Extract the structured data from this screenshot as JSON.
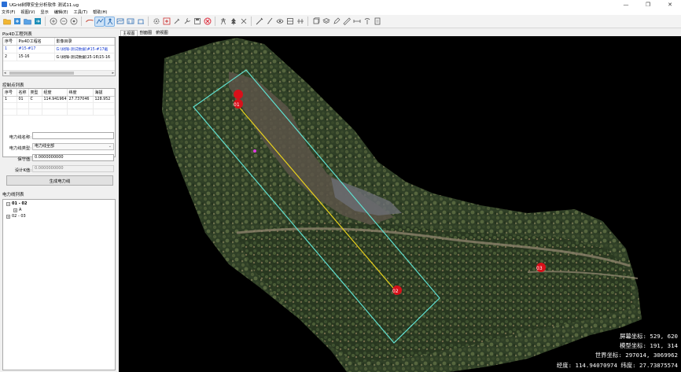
{
  "window": {
    "title": "UGrid树障安全分析软件 测试11.ug",
    "buttons": [
      "—",
      "❐",
      "✕"
    ]
  },
  "menu": [
    "文件(F)",
    "视图(V)",
    "显示",
    "编辑(E)",
    "工具(T)",
    "帮助(H)"
  ],
  "toolbar": {
    "icons": [
      "open-folder-icon",
      "import-icon",
      "save-icon",
      "export-icon",
      "zoom-in-icon",
      "zoom-out-icon",
      "full-extent-icon",
      "pan-hand-icon",
      "select-icon",
      "point-cloud-icon",
      "measure-icon",
      "box-select-icon",
      "profile-icon",
      "settings-gear-icon",
      "add-point-icon",
      "filter-icon",
      "tools-icon",
      "save-disk-icon",
      "stop-icon",
      "help-icon",
      "tower-icon",
      "tree-icon",
      "classify-icon",
      "draw-line-icon",
      "brush-icon",
      "eye-icon",
      "layers-icon",
      "cube-icon",
      "stack-icon",
      "edit-icon",
      "ruler-icon",
      "wrench-icon",
      "antenna-icon",
      "report-icon"
    ],
    "active": [
      7,
      8
    ]
  },
  "project_panel": {
    "title": "Pix4D工程列表",
    "columns": [
      "序号",
      "Pix4D工程名",
      "影像目录"
    ],
    "rows": [
      [
        "1",
        "#15-#17",
        "G:\\树障-测试数据\\#15-#17截"
      ],
      [
        "2",
        "15-16",
        "G:\\树障-测试数据\\15-16\\15-16"
      ]
    ]
  },
  "control_points": {
    "title": "控制点列表",
    "columns": [
      "序号",
      "名称",
      "类型",
      "经度",
      "纬度",
      "海拔"
    ],
    "rows": [
      [
        "1",
        "01",
        "C",
        "114.941964",
        "27.737046",
        "128.952"
      ]
    ]
  },
  "powerline_form": {
    "name_label": "电力线名称:",
    "name_value": "",
    "type_label": "电力线类型:",
    "type_value": "电力线全部",
    "code_label": "保守值:",
    "code_value": "0.0000000000",
    "design_label": "设计K值:",
    "design_value": "0.0000000000",
    "generate_button": "生成电力线"
  },
  "powerline_list": {
    "title": "电力线列表",
    "items": [
      {
        "label": "01 - 02",
        "expanded": true,
        "children": [
          "A"
        ]
      },
      {
        "label": "02 - 03",
        "expanded": false,
        "children": []
      }
    ]
  },
  "view_tabs": [
    "主视图",
    "剖面图",
    "俯视图"
  ],
  "markers": [
    "01",
    "02",
    "03"
  ],
  "status": {
    "screen_coord": "屏幕坐标: 529, 620",
    "model_coord": "模型坐标: 191, 314",
    "world_coord": "世界坐标: 297014, 3069962",
    "latlon": "经度: 114.94070974 纬度: 27.73875574"
  },
  "colors": {
    "corridor": "#5fe0d0",
    "powerline": "#e8d21c",
    "marker": "#d8101a",
    "accent_blue": "#1b3fd1"
  }
}
